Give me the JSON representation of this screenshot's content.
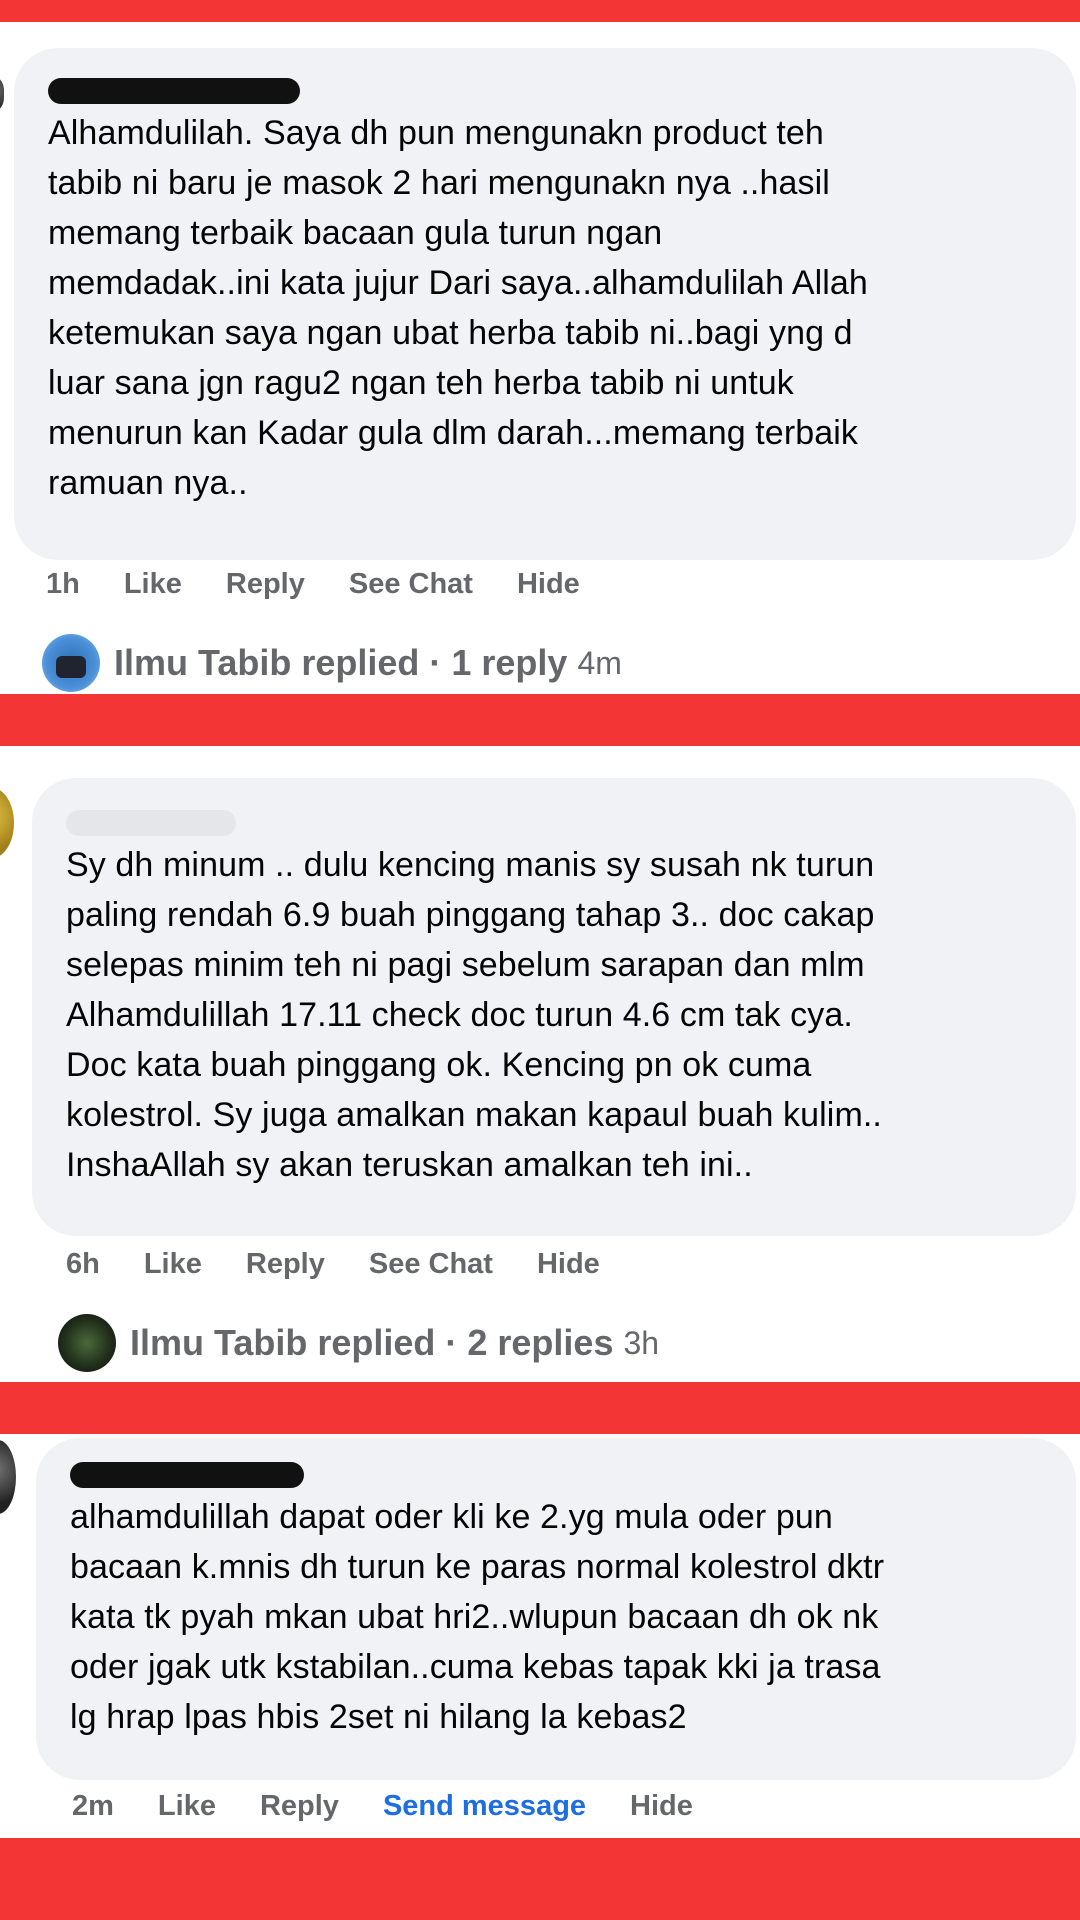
{
  "comments": [
    {
      "text": "Alhamdulilah. Saya dh pun mengunakn product teh\ntabib ni baru je masok 2 hari mengunakn nya ..hasil\nmemang terbaik bacaan gula turun ngan\nmemdadak..ini kata jujur Dari saya..alhamdulilah Allah\nketemukan saya ngan ubat herba tabib ni..bagi yng d\nluar sana jgn ragu2 ngan teh herba tabib ni untuk\nmenurun kan Kadar gula dlm darah...memang terbaik\nramuan nya..",
      "time": "1h",
      "actions": [
        "Like",
        "Reply",
        "See Chat",
        "Hide"
      ],
      "replier": "Ilmu Tabib replied",
      "reply_count": "1 reply",
      "reply_time": "4m"
    },
    {
      "text": "Sy dh minum .. dulu kencing manis sy susah nk turun\npaling rendah 6.9 buah pinggang tahap 3.. doc cakap\nselepas minim teh ni pagi sebelum sarapan dan mlm\nAlhamdulillah 17.11 check doc turun 4.6 cm tak cya.\nDoc kata buah pinggang ok. Kencing pn ok cuma\nkolestrol. Sy juga amalkan makan kapaul buah kulim..\nInshaAllah sy akan teruskan amalkan teh ini..",
      "time": "6h",
      "actions": [
        "Like",
        "Reply",
        "See Chat",
        "Hide"
      ],
      "replier": "Ilmu Tabib replied",
      "reply_count": "2 replies",
      "reply_time": "3h"
    },
    {
      "text": "alhamdulillah dapat oder kli ke 2.yg mula oder pun\nbacaan k.mnis dh turun ke paras normal kolestrol dktr\nkata tk pyah mkan ubat hri2..wlupun bacaan dh ok nk\noder jgak utk kstabilan..cuma kebas tapak kki ja trasa\nlg hrap lpas hbis 2set ni hilang la kebas2",
      "time": "2m",
      "actions": [
        "Like",
        "Reply",
        "Send message",
        "Hide"
      ]
    }
  ],
  "colors": {
    "band": "#f33535",
    "bubble": "#f0f2f5",
    "link": "#1d6fe0",
    "muted": "#65676b"
  }
}
